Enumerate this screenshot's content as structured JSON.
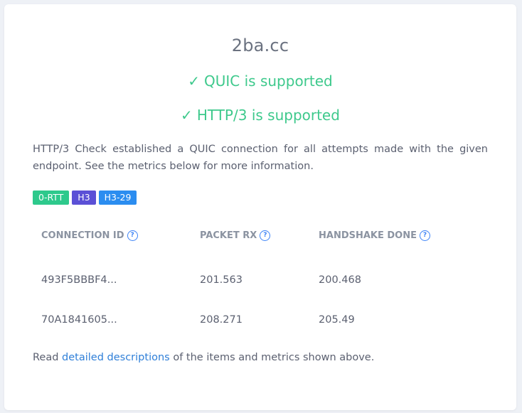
{
  "domain": "2ba.cc",
  "status": {
    "check_glyph": "✓",
    "quic": "QUIC is supported",
    "http3": "HTTP/3 is supported"
  },
  "description": "HTTP/3 Check established a QUIC connection for all attempts made with the given endpoint. See the metrics below for more information.",
  "badges": [
    "0-RTT",
    "H3",
    "H3-29"
  ],
  "badge_colors": [
    "#2ec98c",
    "#5b50d6",
    "#2b8df0"
  ],
  "table": {
    "headers": [
      "CONNECTION ID",
      "PACKET RX",
      "HANDSHAKE DONE"
    ],
    "rows": [
      [
        "493F5BBBF4...",
        "201.563",
        "200.468"
      ],
      [
        "70A1841605...",
        "208.271",
        "205.49"
      ]
    ]
  },
  "footer": {
    "prefix": "Read ",
    "link": "detailed descriptions",
    "suffix": " of the items and metrics shown above."
  },
  "colors": {
    "success": "#3ec98c",
    "link": "#2f7fd8"
  }
}
